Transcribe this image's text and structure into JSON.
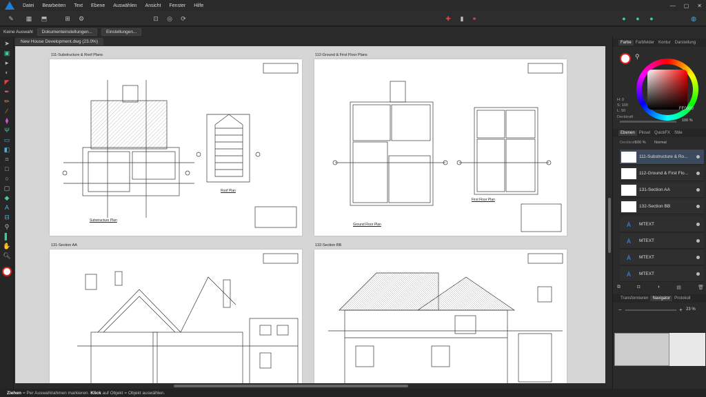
{
  "menu": [
    "Datei",
    "Bearbeiten",
    "Text",
    "Ebene",
    "Auswählen",
    "Ansicht",
    "Fenster",
    "Hilfe"
  ],
  "context": {
    "selection": "Keine Auswahl",
    "doc_settings": "Dokumenteinstellungen...",
    "settings": "Einstellungen..."
  },
  "document": {
    "tab": "New House Development.dwg (23.0%)",
    "pages": [
      {
        "title": "111-Substructure & Roof Plans",
        "sub1": "Substructure Plan",
        "sub2": "Roof Plan"
      },
      {
        "title": "112-Ground & First Floor Plans",
        "sub1": "Ground Floor Plan",
        "sub2": "First Floor Plan"
      },
      {
        "title": "131-Section AA"
      },
      {
        "title": "132-Section BB"
      }
    ]
  },
  "panel": {
    "top_tabs": [
      "Farbe",
      "Farbfelder",
      "Kontur",
      "Darstellung"
    ],
    "color": {
      "h": "H: 0",
      "s": "S: 100",
      "l": "L: 50",
      "hex": "FF0000",
      "opacity_label": "Deckkraft",
      "opacity": "100 %"
    },
    "layer_tabs": [
      "Ebenen",
      "Pinsel",
      "QuickFX",
      "Stile"
    ],
    "layer_opacity_label": "Deckkraft:",
    "layer_opacity": "100 %",
    "blend": "Normal",
    "layers": [
      "111-Substructure & Ro...",
      "112-Ground & First Flo...",
      "131-Section AA",
      "132-Section BB",
      "MTEXT",
      "MTEXT",
      "MTEXT",
      "MTEXT"
    ],
    "nav_tabs": [
      "Transformieren",
      "Navigator",
      "Protokoll"
    ],
    "zoom": "23 %"
  },
  "status": {
    "drag": "Ziehen",
    "drag_text": "= Per Auswahlrahmen markieren.",
    "click": "Klick",
    "click_text": "auf Objekt = Objekt auswählen."
  },
  "accent": "#1a7fd6"
}
